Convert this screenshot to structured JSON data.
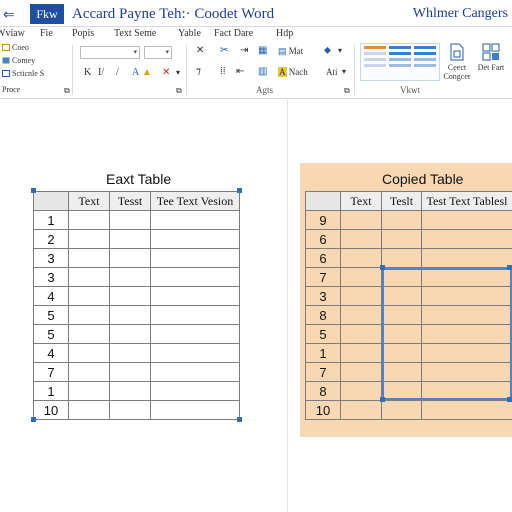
{
  "titlebar": {
    "file_tab": "Fkw",
    "doc_title": "Accard Payne Teh:· Coodet Word",
    "right_title": "Whlmer Cangers"
  },
  "menu": {
    "items": [
      "Wviaw",
      "Fie",
      "Popis",
      "Text Seme",
      "Yable",
      "Fact Dare",
      "Hdp"
    ]
  },
  "ribbon": {
    "clipboard": [
      "Coeo",
      "Comey",
      "Scticnle S",
      "Proce"
    ],
    "groups": {
      "paragraph_label": "Agts",
      "styles_label": "Vkwt"
    },
    "tools_row1": [
      "✕",
      "✂",
      "Mat",
      "⬥"
    ],
    "tools_row2": [
      "K",
      "I/",
      "/",
      "A",
      "✕"
    ],
    "tools_row3": [
      "⁊",
      "Nach",
      "Ati"
    ],
    "buttons": [
      {
        "label": "Ceect Congcer"
      },
      {
        "label": "Det Fart"
      }
    ]
  },
  "doc": {
    "left_table": {
      "title": "Eaxt Table",
      "headers": [
        "",
        "Text",
        "Tesst",
        "Tee Text Vesion"
      ],
      "rows": [
        "1",
        "2",
        "3",
        "3",
        "4",
        "5",
        "5",
        "4",
        "7",
        "1",
        "10"
      ]
    },
    "right_table": {
      "title": "Copied Table",
      "headers": [
        "",
        "Text",
        "Teslt",
        "Test Text Tablesl"
      ],
      "rows": [
        "9",
        "6",
        "6",
        "7",
        "3",
        "8",
        "5",
        "1",
        "7",
        "8",
        "10"
      ]
    }
  },
  "colors": {
    "accent": "#1f4fa0",
    "copied_background": "#f8d8b2",
    "selection": "#4a86cf",
    "handle": "#2f6fb5"
  }
}
